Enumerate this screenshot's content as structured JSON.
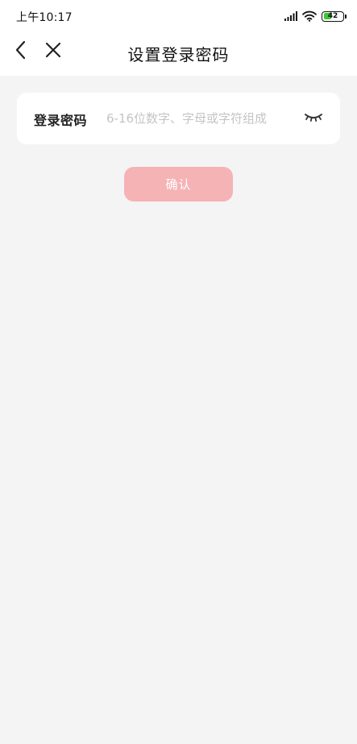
{
  "status_bar": {
    "time": "上午10:17",
    "battery_level": "42",
    "battery_fraction": 0.42,
    "battery_color": "#3ac934",
    "icons": [
      "signal-icon",
      "wifi-icon",
      "battery-icon"
    ]
  },
  "header": {
    "title": "设置登录密码",
    "back_icon": "chevron-left-icon",
    "close_icon": "close-icon"
  },
  "form": {
    "password_label": "登录密码",
    "password_value": "",
    "password_placeholder": "6-16位数字、字母或字符组成",
    "visibility_icon": "eye-closed-icon"
  },
  "actions": {
    "confirm_label": "确认",
    "confirm_color": "#f5b3b6"
  },
  "colors": {
    "background": "#f4f4f4",
    "card": "#ffffff",
    "placeholder": "#c4c4c4"
  }
}
